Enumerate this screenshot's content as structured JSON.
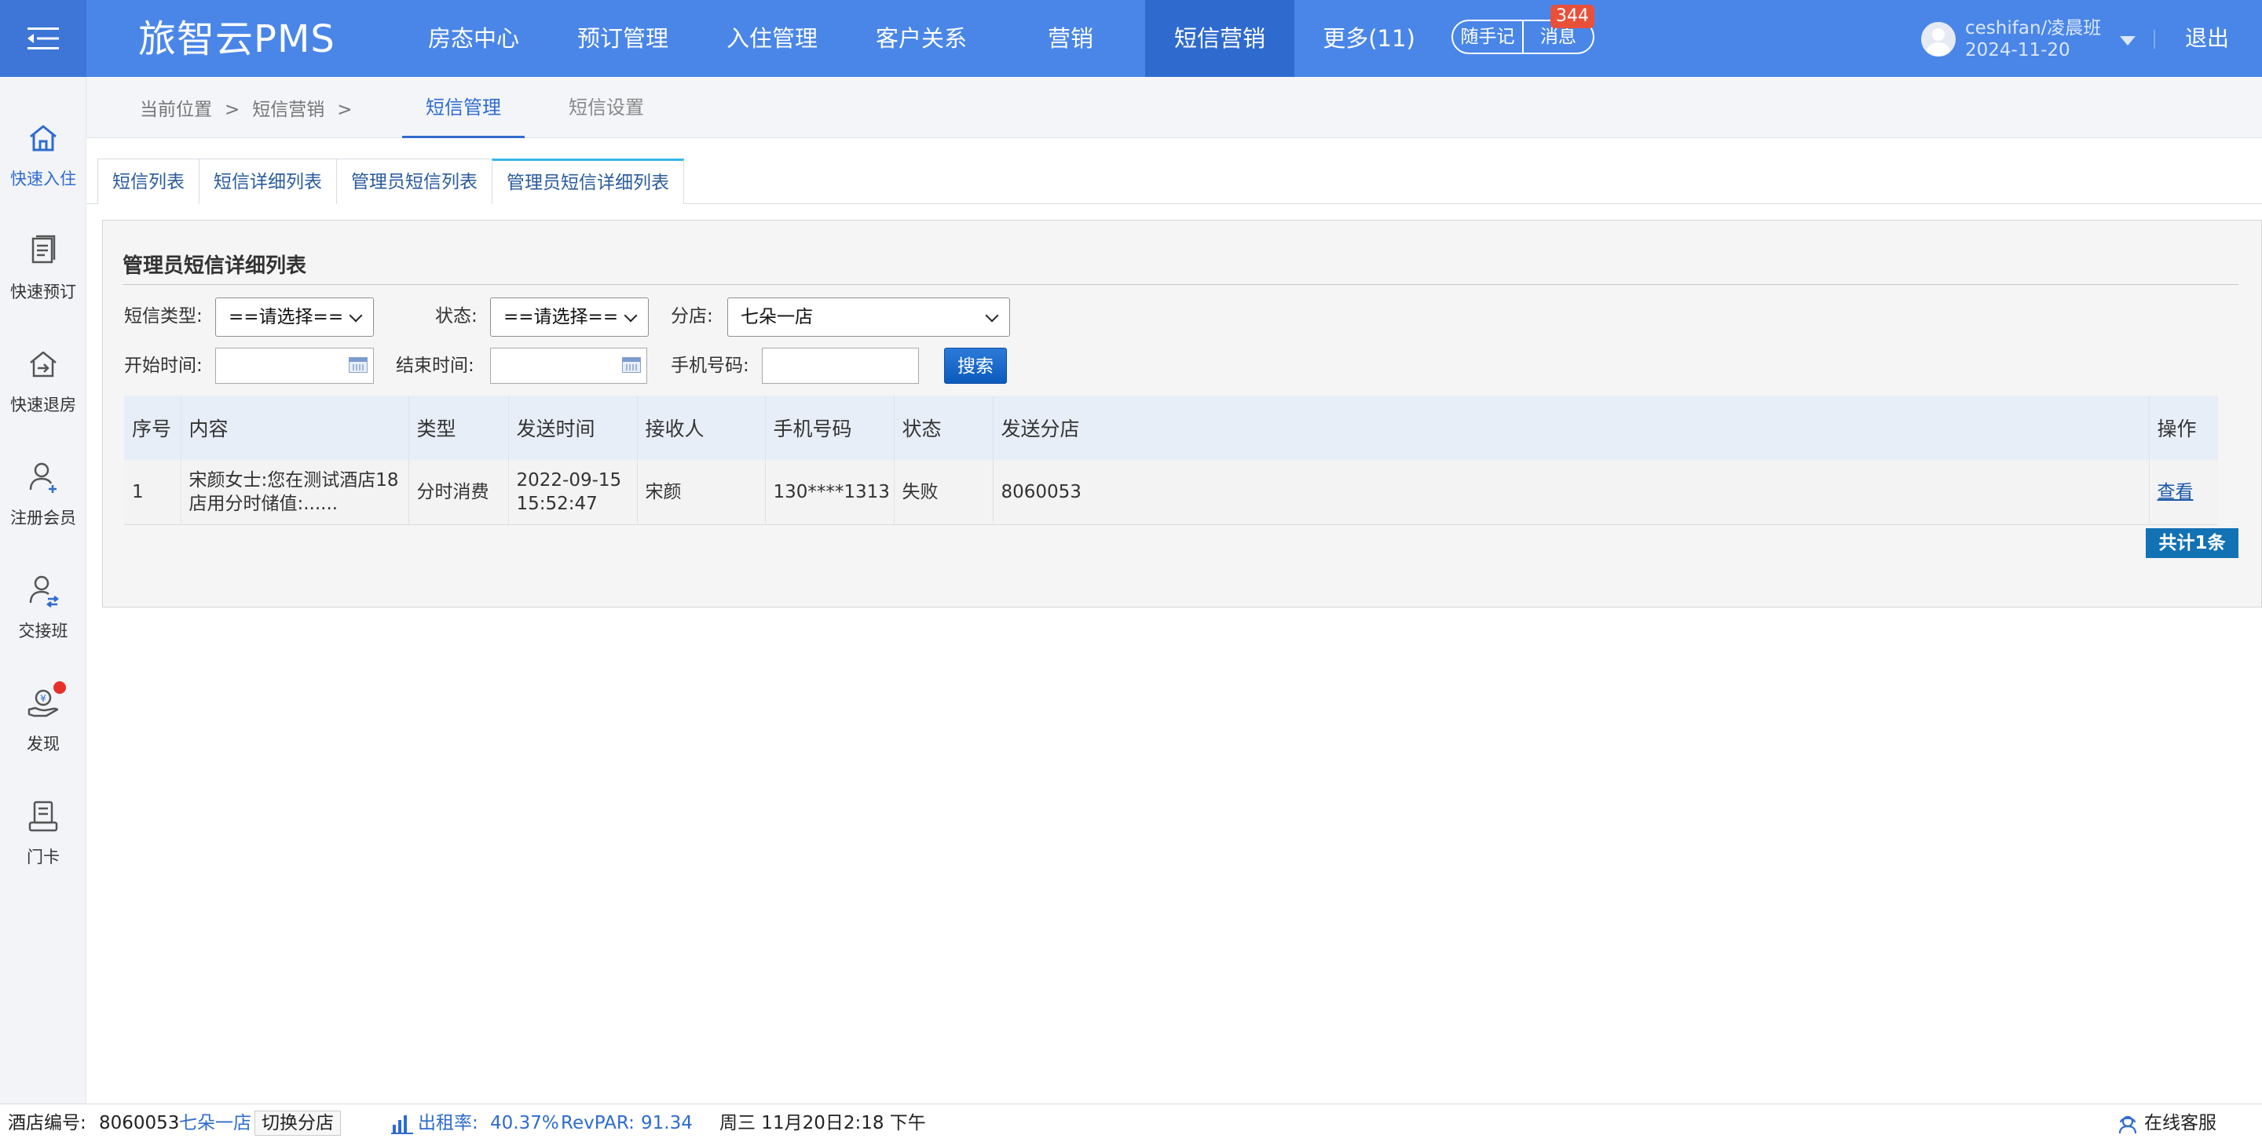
{
  "app": {
    "brand": "旅智云PMS",
    "accent_color": "#4a86e8"
  },
  "nav": {
    "items": [
      {
        "label": "房态中心"
      },
      {
        "label": "预订管理"
      },
      {
        "label": "入住管理"
      },
      {
        "label": "客户关系"
      },
      {
        "label": "营销"
      },
      {
        "label": "短信营销",
        "active": true
      },
      {
        "label": "更多(11)"
      }
    ],
    "memo_label": "随手记",
    "message_label": "消息",
    "message_count": "344"
  },
  "user": {
    "name": "ceshifan/凌晨班",
    "date": "2024-11-20",
    "logout_label": "退出"
  },
  "sidebar": {
    "items": [
      {
        "label": "快速入住",
        "icon": "home-icon"
      },
      {
        "label": "快速预订",
        "icon": "document-list-icon"
      },
      {
        "label": "快速退房",
        "icon": "checkout-house-icon"
      },
      {
        "label": "注册会员",
        "icon": "add-user-icon"
      },
      {
        "label": "交接班",
        "icon": "shift-handover-icon"
      },
      {
        "label": "发现",
        "icon": "discover-money-icon"
      },
      {
        "label": "门卡",
        "icon": "door-card-icon"
      }
    ]
  },
  "breadcrumb": {
    "current_label": "当前位置",
    "sep": ">",
    "section": "短信营销",
    "sep2": ">"
  },
  "subtabs": [
    {
      "label": "短信管理",
      "active": true
    },
    {
      "label": "短信设置",
      "active": false
    }
  ],
  "tabs": [
    {
      "label": "短信列表"
    },
    {
      "label": "短信详细列表"
    },
    {
      "label": "管理员短信列表"
    },
    {
      "label": "管理员短信详细列表",
      "active": true
    }
  ],
  "panel": {
    "title": "管理员短信详细列表"
  },
  "filters": {
    "sms_type_label": "短信类型:",
    "sms_type_value": "==请选择==",
    "status_label": "状态:",
    "status_value": "==请选择==",
    "branch_label": "分店:",
    "branch_value": "七朵一店",
    "start_label": "开始时间:",
    "start_value": "",
    "end_label": "结束时间:",
    "end_value": "",
    "phone_label": "手机号码:",
    "phone_value": "",
    "search_label": "搜索"
  },
  "table": {
    "headers": [
      "序号",
      "内容",
      "类型",
      "发送时间",
      "接收人",
      "手机号码",
      "状态",
      "发送分店",
      "操作"
    ],
    "rows": [
      {
        "no": "1",
        "content": "宋颜女士:您在测试酒店18店用分时储值:......",
        "type": "分时消费",
        "send_time": "2022-09-15 15:52:47",
        "receiver": "宋颜",
        "phone": "130****1313",
        "status": "失败",
        "branch": "8060053",
        "action": "查看"
      }
    ],
    "total_label": "共计1条"
  },
  "footer": {
    "hotel_code_label": "酒店编号:",
    "hotel_code": "8060053",
    "hotel_name": "七朵一店",
    "switch_label": "切换分店",
    "occupancy_label": "出租率:",
    "occupancy": "40.37%",
    "revpar_label": "RevPAR:",
    "revpar": "91.34",
    "datetime": "周三 11月20日2:18 下午",
    "support_label": "在线客服"
  }
}
